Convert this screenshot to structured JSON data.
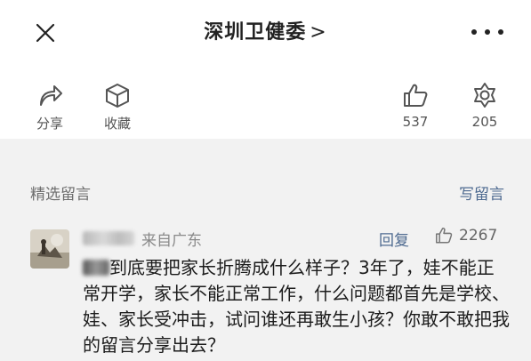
{
  "header": {
    "title": "深圳卫健委",
    "title_chevron": ">",
    "close_icon": "close-icon",
    "more_icon": "more-dots-icon"
  },
  "actions": [
    {
      "id": "share",
      "icon": "share-arrow-icon",
      "label": "分享"
    },
    {
      "id": "favorite",
      "icon": "cube-icon",
      "label": "收藏"
    },
    {
      "id": "like",
      "icon": "thumbs-up-icon",
      "label": "537"
    },
    {
      "id": "wow",
      "icon": "flower-icon",
      "label": "205"
    }
  ],
  "comments_section": {
    "title": "精选留言",
    "write_label": "写留言",
    "background": "#f2f2f2",
    "link_color": "#4e6a90"
  },
  "comment": {
    "location": "来自广东",
    "reply_label": "回复",
    "like_count": "2267",
    "text_tail": "到底要把家长折腾成什么样子？3年了，娃不能正常开学，家长不能正常工作，什么问题都首先是学校、娃、家长受冲击，试问谁还再敢生小孩？你敢不敢把我的留言分享出去？"
  }
}
